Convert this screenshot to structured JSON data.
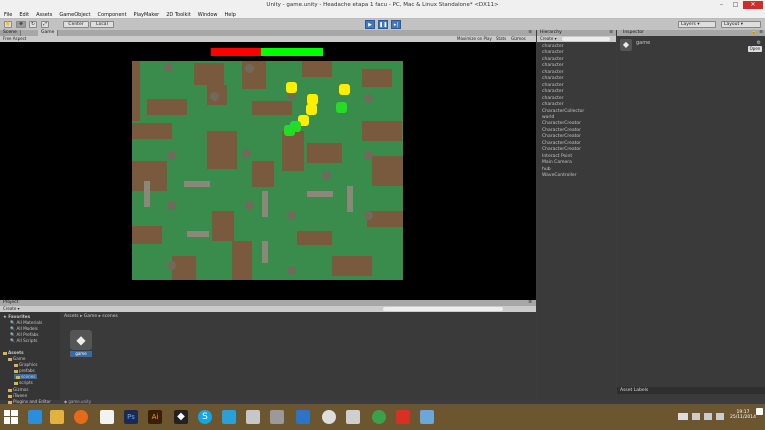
{
  "window": {
    "title": "Unity - game.unity - Headache etapa 1 facu - PC, Mac & Linux Standalone* <DX11>"
  },
  "menu": [
    "File",
    "Edit",
    "Assets",
    "GameObject",
    "Component",
    "PlayMaker",
    "2D Toolkit",
    "Window",
    "Help"
  ],
  "toolbar": {
    "pivot": "Center",
    "space": "Local",
    "layers": "Layers",
    "layout": "Layout"
  },
  "scene_panel": {
    "tabs": [
      "Scene",
      "Game"
    ],
    "aspect": "Free Aspect",
    "options": [
      "Maximize on Play",
      "Stats",
      "Gizmos"
    ]
  },
  "health_bar": {
    "value": 0.45,
    "fill_color": "#ff0000",
    "rest_color": "#00ff00"
  },
  "hierarchy": {
    "title": "Hierarchy",
    "create": "Create",
    "items": [
      "character",
      "character",
      "character",
      "character",
      "character",
      "character",
      "character",
      "character",
      "character",
      "character",
      "CharacterCollector",
      "world",
      "CharacterCreator",
      "CharacterCreator",
      "CharacterCreator",
      "CharacterCreator",
      "CharacterCreator",
      "Interact Point",
      "Main Camera",
      "hub",
      "WaveController"
    ]
  },
  "inspector": {
    "title": "Inspector",
    "object": "game",
    "open_label": "Open",
    "asset_labels": "Asset Labels"
  },
  "project": {
    "title": "Project",
    "create": "Create",
    "breadcrumb": "Assets ▸ Game ▸ scenes",
    "favorites": "Favorites",
    "fav_items": [
      "All Materials",
      "All Models",
      "All Prefabs",
      "All Scripts"
    ],
    "assets": "Assets",
    "tree": [
      "Game",
      "Graphics",
      "prefabs",
      "scenes",
      "scripts",
      "Gizmos",
      "iTween",
      "Plugins and Editor"
    ],
    "asset_name": "game",
    "footer": "game.unity"
  },
  "taskbar": {
    "time": "19:17",
    "date": "25/11/2014"
  },
  "colors": {
    "grass": "#3a8c4c",
    "dirt": "#7a5a3e",
    "yellow": "#ffee00",
    "green_char": "#22dd22"
  }
}
